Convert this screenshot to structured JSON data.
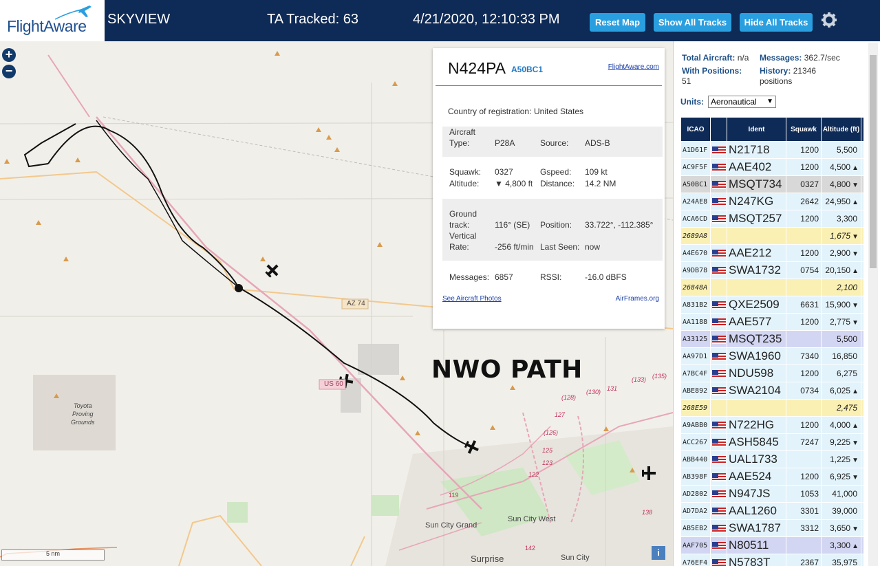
{
  "header": {
    "logo_text": "FlightAware",
    "app_name": "SKYVIEW",
    "tracked": "TA Tracked: 63",
    "datetime": "4/21/2020, 12:10:33 PM",
    "buttons": {
      "reset": "Reset Map",
      "show": "Show All Tracks",
      "hide": "Hide All Tracks"
    }
  },
  "map": {
    "zoom_in": "+",
    "zoom_out": "−",
    "overlay_text": "NWO PATH",
    "scale_label": "5 nm",
    "info_button": "i",
    "labels": {
      "toyota": "Toyota",
      "proving": "Proving",
      "grounds": "Grounds",
      "az74": "AZ 74",
      "us60": "US 60",
      "sun_city_grand": "Sun City Grand",
      "sun_city_west": "Sun City West",
      "sun_city": "Sun City",
      "surprise": "Surprise",
      "r119": "119",
      "r142": "142",
      "r135": "(135)",
      "r133": "(133)",
      "r130": "(130)",
      "r128": "(128)",
      "r127": "127",
      "r126": "(126)",
      "r125": "125",
      "r131": "131",
      "r138": "138",
      "r123": "123",
      "r122": "122"
    }
  },
  "popup": {
    "callsign": "N424PA",
    "hex": "A50BC1",
    "flightaware_link": "FlightAware.com",
    "country_label": "Country of registration:",
    "country": "United States",
    "aircraft_type_label1": "Aircraft",
    "aircraft_type_label2": "Type:",
    "aircraft_type": "P28A",
    "source_label": "Source:",
    "source": "ADS-B",
    "squawk_label": "Squawk:",
    "squawk": "0327",
    "gspeed_label": "Gspeed:",
    "gspeed": "109 kt",
    "altitude_label": "Altitude:",
    "altitude": "▼ 4,800 ft",
    "distance_label": "Distance:",
    "distance": "14.2 NM",
    "track_label1": "Ground",
    "track_label2": "track:",
    "track": "116° (SE)",
    "position_label": "Position:",
    "position": "33.722°, -112.385°",
    "vrate_label1": "Vertical",
    "vrate_label2": "Rate:",
    "vrate": "-256 ft/min",
    "lastseen_label": "Last Seen:",
    "lastseen": "now",
    "messages_label": "Messages:",
    "messages": "6857",
    "rssi_label": "RSSI:",
    "rssi": "-16.0 dBFS",
    "photos_link": "See Aircraft Photos",
    "airframes_link": "AirFrames.org"
  },
  "sidebar": {
    "total_label": "Total Aircraft:",
    "total": "n/a",
    "messages_label": "Messages:",
    "messages": "362.7/sec",
    "withpos_label": "With Positions:",
    "withpos": "51",
    "history_label": "History:",
    "history": "21346",
    "history_unit": "positions",
    "units_label": "Units:",
    "units_value": "Aeronautical",
    "columns": {
      "icao": "ICAO",
      "ident": "Ident",
      "squawk": "Squawk",
      "altitude": "Altitude (ft)"
    },
    "rows": [
      {
        "icao": "A1D61F",
        "ident": "N21718",
        "squawk": "1200",
        "alt": "5,500",
        "trend": "",
        "kind": "normal"
      },
      {
        "icao": "AC9F5F",
        "ident": "AAE402",
        "squawk": "1200",
        "alt": "4,500",
        "trend": "▲",
        "kind": "normal"
      },
      {
        "icao": "A50BC1",
        "ident": "MSQT734",
        "squawk": "0327",
        "alt": "4,800",
        "trend": "▼",
        "kind": "selected"
      },
      {
        "icao": "A24AE8",
        "ident": "N247KG",
        "squawk": "2642",
        "alt": "24,950",
        "trend": "▲",
        "kind": "normal"
      },
      {
        "icao": "ACA6CD",
        "ident": "MSQT257",
        "squawk": "1200",
        "alt": "3,300",
        "trend": "",
        "kind": "normal"
      },
      {
        "icao": "2689A8",
        "ident": "",
        "squawk": "",
        "alt": "1,675",
        "trend": "▼",
        "kind": "yellow"
      },
      {
        "icao": "A4E670",
        "ident": "AAE212",
        "squawk": "1200",
        "alt": "2,900",
        "trend": "▼",
        "kind": "normal"
      },
      {
        "icao": "A9DB78",
        "ident": "SWA1732",
        "squawk": "0754",
        "alt": "20,150",
        "trend": "▲",
        "kind": "normal"
      },
      {
        "icao": "26848A",
        "ident": "",
        "squawk": "",
        "alt": "2,100",
        "trend": "",
        "kind": "yellow"
      },
      {
        "icao": "A831B2",
        "ident": "QXE2509",
        "squawk": "6631",
        "alt": "15,900",
        "trend": "▼",
        "kind": "normal"
      },
      {
        "icao": "AA1188",
        "ident": "AAE577",
        "squawk": "1200",
        "alt": "2,775",
        "trend": "▼",
        "kind": "normal"
      },
      {
        "icao": "A33125",
        "ident": "MSQT235",
        "squawk": "",
        "alt": "5,500",
        "trend": "",
        "kind": "purple"
      },
      {
        "icao": "AA97D1",
        "ident": "SWA1960",
        "squawk": "7340",
        "alt": "16,850",
        "trend": "",
        "kind": "normal"
      },
      {
        "icao": "A7BC4F",
        "ident": "NDU598",
        "squawk": "1200",
        "alt": "6,275",
        "trend": "",
        "kind": "normal"
      },
      {
        "icao": "ABE892",
        "ident": "SWA2104",
        "squawk": "0734",
        "alt": "6,025",
        "trend": "▲",
        "kind": "normal"
      },
      {
        "icao": "268E59",
        "ident": "",
        "squawk": "",
        "alt": "2,475",
        "trend": "",
        "kind": "yellow"
      },
      {
        "icao": "A9ABB0",
        "ident": "N722HG",
        "squawk": "1200",
        "alt": "4,000",
        "trend": "▲",
        "kind": "normal"
      },
      {
        "icao": "ACC267",
        "ident": "ASH5845",
        "squawk": "7247",
        "alt": "9,225",
        "trend": "▼",
        "kind": "normal"
      },
      {
        "icao": "ABB440",
        "ident": "UAL1733",
        "squawk": "",
        "alt": "1,225",
        "trend": "▼",
        "kind": "normal"
      },
      {
        "icao": "AB398F",
        "ident": "AAE524",
        "squawk": "1200",
        "alt": "6,925",
        "trend": "▼",
        "kind": "normal"
      },
      {
        "icao": "AD2802",
        "ident": "N947JS",
        "squawk": "1053",
        "alt": "41,000",
        "trend": "",
        "kind": "normal"
      },
      {
        "icao": "AD7DA2",
        "ident": "AAL1260",
        "squawk": "3301",
        "alt": "39,000",
        "trend": "",
        "kind": "normal"
      },
      {
        "icao": "AB5EB2",
        "ident": "SWA1787",
        "squawk": "3312",
        "alt": "3,650",
        "trend": "▼",
        "kind": "normal"
      },
      {
        "icao": "AAF705",
        "ident": "N80511",
        "squawk": "",
        "alt": "3,300",
        "trend": "▲",
        "kind": "purple"
      },
      {
        "icao": "A76EF4",
        "ident": "N5783T",
        "squawk": "2367",
        "alt": "35,975",
        "trend": "",
        "kind": "normal"
      }
    ]
  },
  "colors": {
    "header_bg": "#0e2a56",
    "button": "#2a9fe0",
    "row_normal": "#e3f3fb",
    "row_yellow": "#fbf0b3",
    "row_purple": "#d3d6f2",
    "row_selected": "#d8d8d8"
  }
}
